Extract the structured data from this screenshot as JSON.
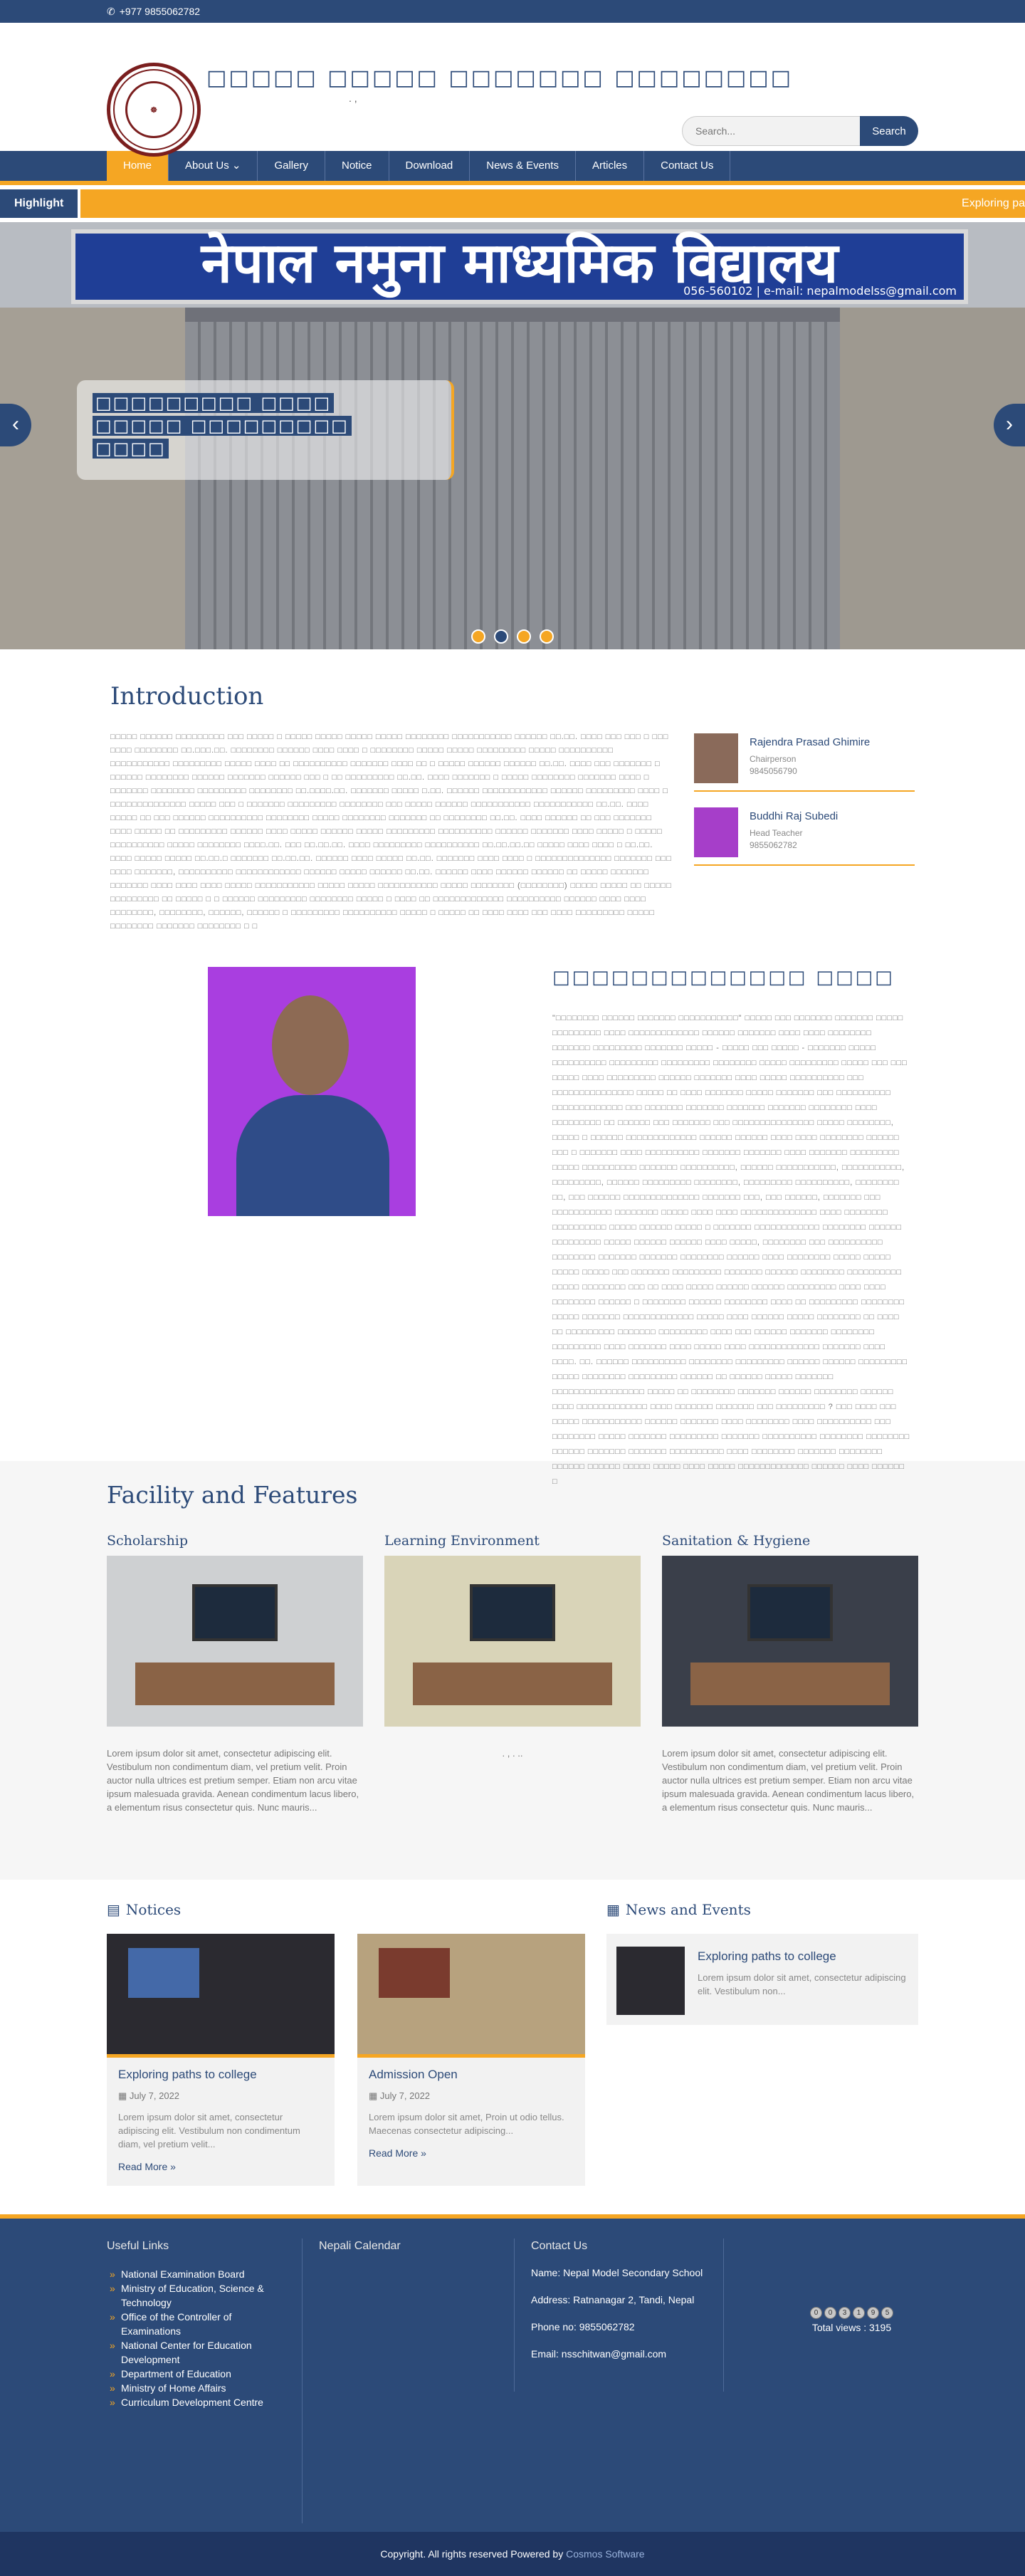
{
  "topbar": {
    "phone": "+977 9855062782"
  },
  "header": {
    "school_name": "□□□□□ □□□□□ □□□□□□□ □□□□□□□□",
    "school_sub": ". ,",
    "logo_text": "NEPAL MODEL SECONDARY SCHOOL RATNANAGAR-2, CHITWAN",
    "search_placeholder": "Search...",
    "search_button": "Search"
  },
  "nav": {
    "items": [
      "Home",
      "About Us",
      "Gallery",
      "Notice",
      "Download",
      "News & Events",
      "Articles",
      "Contact Us"
    ]
  },
  "highlight": {
    "label": "Highlight",
    "ticker": "Exploring pa"
  },
  "slider": {
    "sign_text": "नेपाल नमुना माध्यमिक विद्यालय",
    "sign_small": "056-560102 | e-mail: nepalmodelss@gmail.com",
    "caption_line1": "□□□□□□□□□ □□□□",
    "caption_line2": "□□□□□ □□□□□□□□□",
    "caption_line3": "□□□□"
  },
  "intro": {
    "title": "Introduction",
    "text": "□□□□□ □□□□□□ □□□□□□□□□ □□□ □□□□□ □ □□□□□ □□□□□ □□□□□ □□□□□ □□□□□□□□ □□□□□□□□□□□ □□□□□□ □□.□□. □□□□ □□□ □□□ □ □□□ □□□□ □□□□□□□□ □□.□□□.□□. □□□□□□□□ □□□□□□ □□□□ □□□□ □ □□□□□□□□ □□□□□ □□□□□ □□□□□□□□□ □□□□□ □□□□□□□□□□ □□□□□□□□□□□ □□□□□□□□□ □□□□□ □□□□ □□ □□□□□□□□□□ □□□□□□□ □□□□ □□ □ □□□□□ □□□□□□ □□□□□□ □□.□□. □□□□ □□□ □□□□□□□ □ □□□□□□ □□□□□□□□ □□□□□□ □□□□□□□ □□□□□□ □□□ □ □□ □□□□□□□□□ □□.□□. □□□□ □□□□□□□ □ □□□□□ □□□□□□□□ □□□□□□□ □□□□ □ □□□□□□□ □□□□□□□□ □□□□□□□□□ □□□□□□□□ □□.□□□□.□□. □□□□□□□ □□□□□ □.□□. □□□□□□ □□□□□□□□□□□□ □□□□□□ □□□□□□□□□ □□□□ □ □□□□□□□□□□□□□□ □□□□□ □□□ □ □□□□□□□ □□□□□□□□□ □□□□□□□□ □□□ □□□□□ □□□□□□ □□□□□□□□□□□ □□□□□□□□□□□ □□.□□. □□□□ □□□□□ □□ □□□ □□□□□□ □□□□□□□□□□ □□□□□□□□ □□□□□ □□□□□□□□ □□□□□□□ □□ □□□□□□□□ □□.□□. □□□□ □□□□□□ □□ □□□ □□□□□□□ □□□□ □□□□□ □□ □□□□□□□□□ □□□□□□ □□□□ □□□□□ □□□□□□ □□□□□ □□□□□□□□□ □□□□□□□□□□ □□□□□□ □□□□□□□ □□□□ □□□□□ □ □□□□□ □□□□□□□□□□ □□□□□ □□□□□□□□ □□□□.□□. □□□ □□.□□.□□. □□□□ □□□□□□□□□ □□□□□□□□□□ □□.□□.□□.□□ □□□□□ □□□□ □□□□ □ □□.□□. □□□□ □□□□□ □□□□□ □□.□□.□ □□□□□□□ □□.□□.□□. □□□□□□ □□□□ □□□□□ □□.□□. □□□□□□□ □□□□ □□□□ □ □□□□□□□□□□□□□□ □□□□□□□ □□□ □□□□ □□□□□□□, □□□□□□□□□□ □□□□□□□□□□□□ □□□□□□ □□□□□ □□□□□□ □□.□□. □□□□□□ □□□□ □□□□□□ □□□□□□ □□ □□□□□ □□□□□□□ □□□□□□□ □□□□ □□□□ □□□□ □□□□□ □□□□□□□□□□□ □□□□□ □□□□□ □□□□□□□□□□□ □□□□□ □□□□□□□□ (□□□□□□□□) □□□□□ □□□□□ □□ □□□□□ □□□□□□□□□ □□ □□□□□ □ □ □□□□□□ □□□□□□□□□ □□□□□□□□ □□□□□ □ □□□□ □□ □□□□□□□□□□□□□ □□□□□□□□□□ □□□□□□ □□□□ □□□□ □□□□□□□□, □□□□□□□□, □□□□□□, □□□□□□ □ □□□□□□□□□ □□□□□□□□□□ □□□□□ □ □□□□□ □□ □□□□ □□□□ □□□ □□□□ □□□□□□□□□ □□□□□ □□□□□□□□ □□□□□□□ □□□□□□□□ □ □"
  },
  "people": [
    {
      "name": "Rajendra Prasad Ghimire",
      "role": "Chairperson",
      "phone": "9845056790"
    },
    {
      "name": "Buddhi Raj Subedi",
      "role": "Head Teacher",
      "phone": "9855062782"
    }
  ],
  "message": {
    "title": "□□□□□□□□□□□□□ □□□□",
    "text": "\"□□□□□□□□ □□□□□□ □□□□□□□ □□□□□□□□□□□\" □□□□□ □□□ □□□□□□□ □□□□□□□ □□□□□ □□□□□□□□□ □□□□ □□□□□□□□□□□□□ □□□□□□ □□□□□□□ □□□□ □□□□ □□□□□□□□ □□□□□□□ □□□□□□□□□ □□□□□□□ □□□□□ - □□□□□ □□□ □□□□□ - □□□□□□□ □□□□□ □□□□□□□□□□ □□□□□□□□□ □□□□□□□□□ □□□□□□□□ □□□□□ □□□□□□□□□ □□□□□ □□□ □□□ □□□□□ □□□□ □□□□□□□□□ □□□□□□ □□□□□□□ □□□□ □□□□□ □□□□□□□□□□ □□□ □□□□□□□□□□□□□□□ □□□□□ □□ □□□□ □□□□□□□ □□□□□ □□□□□□□ □□□ □□□□□□□□□□ □□□□□□□□□□□□□ □□□ □□□□□□□ □□□□□□□ □□□□□□□ □□□□□□□ □□□□□□□□ □□□□ □□□□□□□□□ □□ □□□□□□ □□□ □□□□□□□ □□□ □□□□□□□□□□□□□□□ □□□□□ □□□□□□□□, □□□□□ □ □□□□□□ □□□□□□□□□□□□□ □□□□□□ □□□□□□ □□□□ □□□□ □□□□□□□□ □□□□□□ □□□ □ □□□□□□□ □□□□ □□□□□□□□□□ □□□□□□□ □□□□□□□ □□□□ □□□□□□□ □□□□□□□□□ □□□□□ □□□□□□□□□□ □□□□□□□ □□□□□□□□□□, □□□□□□ □□□□□□□□□□□, □□□□□□□□□□□, □□□□□□□□□, □□□□□□ □□□□□□□□□ □□□□□□□□, □□□□□□□□□ □□□□□□□□□□, □□□□□□□□ □□, □□□ □□□□□□ □□□□□□□□□□□□□□ □□□□□□□ □□□, □□□ □□□□□□, □□□□□□□ □□□ □□□□□□□□□□□ □□□□□□□□ □□□□□ □□□□ □□□□ □□□□□□□□□□□□□□ □□□□ □□□□□□□□ □□□□□□□□□□ □□□□□ □□□□□□ □□□□□ □ □□□□□□□ □□□□□□□□□□□□ □□□□□□□□ □□□□□□ □□□□□□□□□ □□□□□ □□□□□□ □□□□□□ □□□□ □□□□□, □□□□□□□□ □□□ □□□□□□□□□□ □□□□□□□□ □□□□□□□ □□□□□□□ □□□□□□□□ □□□□□□ □□□□ □□□□□□□□ □□□□□ □□□□□ □□□□□ □□□□□ □□□ □□□□□□□ □□□□□□□□□ □□□□□□□ □□□□□□ □□□□□□□□ □□□□□□□□□□ □□□□□ □□□□□□□□ □□□ □□ □□□□ □□□□□ □□□□□□ □□□□□□ □□□□□□□□□ □□□□ □□□□ □□□□□□□□ □□□□□□ □ □□□□□□□□ □□□□□□ □□□□□□□□ □□□□ □□ □□□□□□□□□ □□□□□□□□ □□□□□ □□□□□□□ □□□□□□□□□□□□□ □□□□□ □□□□ □□□□□□ □□□□□ □□□□□□□□ □□ □□□□ □□ □□□□□□□□□ □□□□□□□ □□□□□□□□□ □□□□ □□□ □□□□□□ □□□□□□□ □□□□□□□□ □□□□□□□□□ □□□□ □□□□□□□ □□□□ □□□□□ □□□□ □□□□□□□□□□□□□ □□□□□□□ □□□□ □□□□. □□. □□□□□□ □□□□□□□□□□ □□□□□□□□ □□□□□□□□□ □□□□□□ □□□□□□ □□□□□□□□□ □□□□□ □□□□□□□□ □□□□□□□□□ □□□□□□ □□ □□□□□□ □□□□□ □□□□□□□ □□□□□□□□□□□□□□□□□ □□□□□ □□ □□□□□□□□ □□□□□□□ □□□□□□ □□□□□□□□ □□□□□□ □□□□ □□□□□□□□□□□□□ □□□□ □□□□□□□ □□□□□□□ □□□ □□□□□□□□□ ? □□□ □□□□ □□□ □□□□□ □□□□□□□□□□□ □□□□□□ □□□□□□□ □□□□ □□□□□□□□ □□□□ □□□□□□□□□□ □□□ □□□□□□□□ □□□□□ □□□□□□□ □□□□□□□□□ □□□□□□□ □□□□□□□□□□ □□□□□□□□ □□□□□□□□ □□□□□□ □□□□□□□ □□□□□□□ □□□□□□□□□□ □□□□ □□□□□□□□ □□□□□□□ □□□□□□□□ □□□□□□ □□□□□□ □□□□□ □□□□□ □□□□ □□□□□ □□□□□□□□□□□□□ □□□□□□ □□□□ □□□□□□ □"
  },
  "facility": {
    "title": "Facility and Features",
    "items": [
      {
        "title": "Scholarship",
        "text": "Lorem ipsum dolor sit amet, consectetur adipiscing elit. Vestibulum non condimentum diam, vel pretium velit. Proin auctor nulla ultrices est pretium semper. Etiam non arcu vitae ipsum malesuada gravida. Aenean condimentum lacus libero, a elementum risus consectetur quis. Nunc mauris..."
      },
      {
        "title": "Learning Environment",
        "text": ". , . .."
      },
      {
        "title": "Sanitation & Hygiene",
        "text": "Lorem ipsum dolor sit amet, consectetur adipiscing elit. Vestibulum non condimentum diam, vel pretium velit. Proin auctor nulla ultrices est pretium semper. Etiam non arcu vitae ipsum malesuada gravida. Aenean condimentum lacus libero, a elementum risus consectetur quis. Nunc mauris..."
      }
    ]
  },
  "notices": {
    "title": "Notices",
    "items": [
      {
        "title": "Exploring paths to college",
        "date": "July 7, 2022",
        "text": "Lorem ipsum dolor sit amet, consectetur adipiscing elit. Vestibulum non condimentum diam, vel pretium velit...",
        "more": "Read More »"
      },
      {
        "title": "Admission Open",
        "date": "July 7, 2022",
        "text": "Lorem ipsum dolor sit amet, Proin ut odio tellus. Maecenas consectetur adipiscing...",
        "more": "Read More »"
      }
    ]
  },
  "events": {
    "title": "News and Events",
    "items": [
      {
        "title": "Exploring paths to college",
        "text": "Lorem ipsum dolor sit amet, consectetur adipiscing elit. Vestibulum non..."
      }
    ]
  },
  "footer": {
    "links_title": "Useful Links",
    "links": [
      "National Examination Board",
      "Ministry of Education, Science & Technology",
      "Office of the Controller of Examinations",
      "National Center for Education Development",
      "Department of Education",
      "Ministry of Home Affairs",
      "Curriculum Development Centre"
    ],
    "calendar_title": "Nepali Calendar",
    "contact_title": "Contact Us",
    "contact_name": "Name: Nepal Model Secondary School",
    "contact_address": "Address: Ratnanagar 2, Tandi, Nepal",
    "contact_phone": "Phone no: 9855062782",
    "contact_email": "Email: nsschitwan@gmail.com",
    "counter_digits": [
      "0",
      "0",
      "3",
      "1",
      "9",
      "5"
    ],
    "views": "Total views : 3195"
  },
  "bottom": {
    "text": "Copyright. All rights reserved Powered by ",
    "company": "Cosmos Software"
  },
  "colors": {
    "primary": "#2c4a78",
    "accent": "#f5a623"
  }
}
